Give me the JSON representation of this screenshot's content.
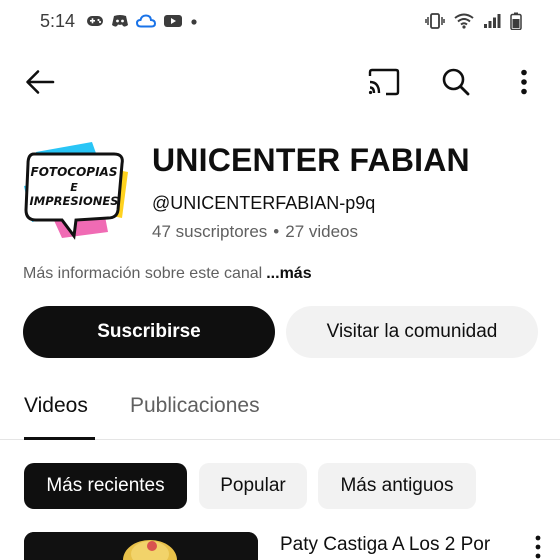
{
  "status_bar": {
    "time": "5:14",
    "icons_left": [
      "gamepad-icon",
      "discord-icon",
      "cloud-icon",
      "youtube-icon",
      "dot-icon"
    ],
    "icons_right": [
      "vibrate-icon",
      "wifi-icon",
      "signal-icon",
      "battery-icon"
    ]
  },
  "top_bar": {
    "icons": [
      "back-arrow-icon",
      "cast-icon",
      "search-icon",
      "more-vert-icon"
    ]
  },
  "channel": {
    "avatar_text_line1": "FOTOCOPIAS",
    "avatar_text_line2": "E",
    "avatar_text_line3": "IMPRESIONES",
    "name": "UNICENTER FABIAN",
    "handle": "@UNICENTERFABIAN-p9q",
    "subscribers": "47 suscriptores",
    "separator": "•",
    "videos_count": "27 videos",
    "about": "Más información sobre este canal",
    "about_more": "...más"
  },
  "actions": {
    "subscribe": "Suscribirse",
    "community": "Visitar la comunidad"
  },
  "tabs": [
    {
      "label": "Videos",
      "active": true
    },
    {
      "label": "Publicaciones",
      "active": false
    }
  ],
  "filters": [
    {
      "label": "Más recientes",
      "active": true
    },
    {
      "label": "Popular",
      "active": false
    },
    {
      "label": "Más antiguos",
      "active": false
    }
  ],
  "videos": [
    {
      "title": "Paty Castiga A Los 2 Por"
    }
  ],
  "colors": {
    "primary_text": "#0f0f0f",
    "secondary_text": "#606060",
    "chip_bg": "#f2f2f2",
    "avatar_cyan": "#29c5f6",
    "avatar_pink": "#f06bb4",
    "avatar_yellow": "#ffd21f"
  }
}
